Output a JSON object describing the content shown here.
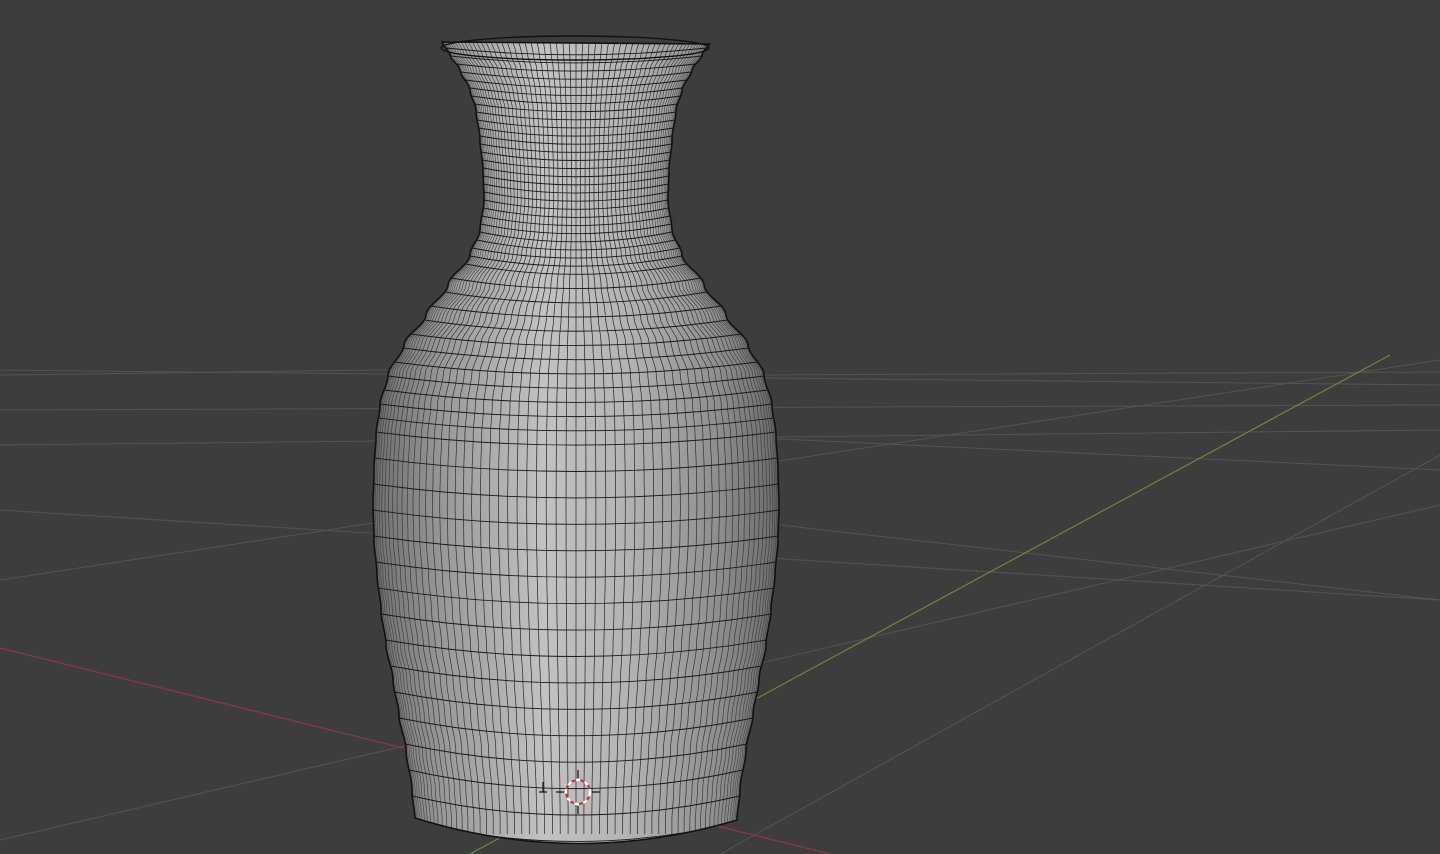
{
  "viewport": {
    "background_color": "#3d3d3d",
    "grid_color": "#545454",
    "x_axis_color": "#8a3a45",
    "y_axis_color": "#6a8a3a",
    "show_grid": true,
    "show_wireframe": true
  },
  "object": {
    "kind": "vase-mesh",
    "shading": "solid",
    "mesh_color": "#a8a8a8",
    "wire_color": "#1a1a1a"
  },
  "cursor": {
    "icon": "3d-cursor-icon",
    "ring_colors": [
      "#d03030",
      "#ffffff"
    ]
  },
  "origin": {
    "icon": "object-origin-icon"
  }
}
